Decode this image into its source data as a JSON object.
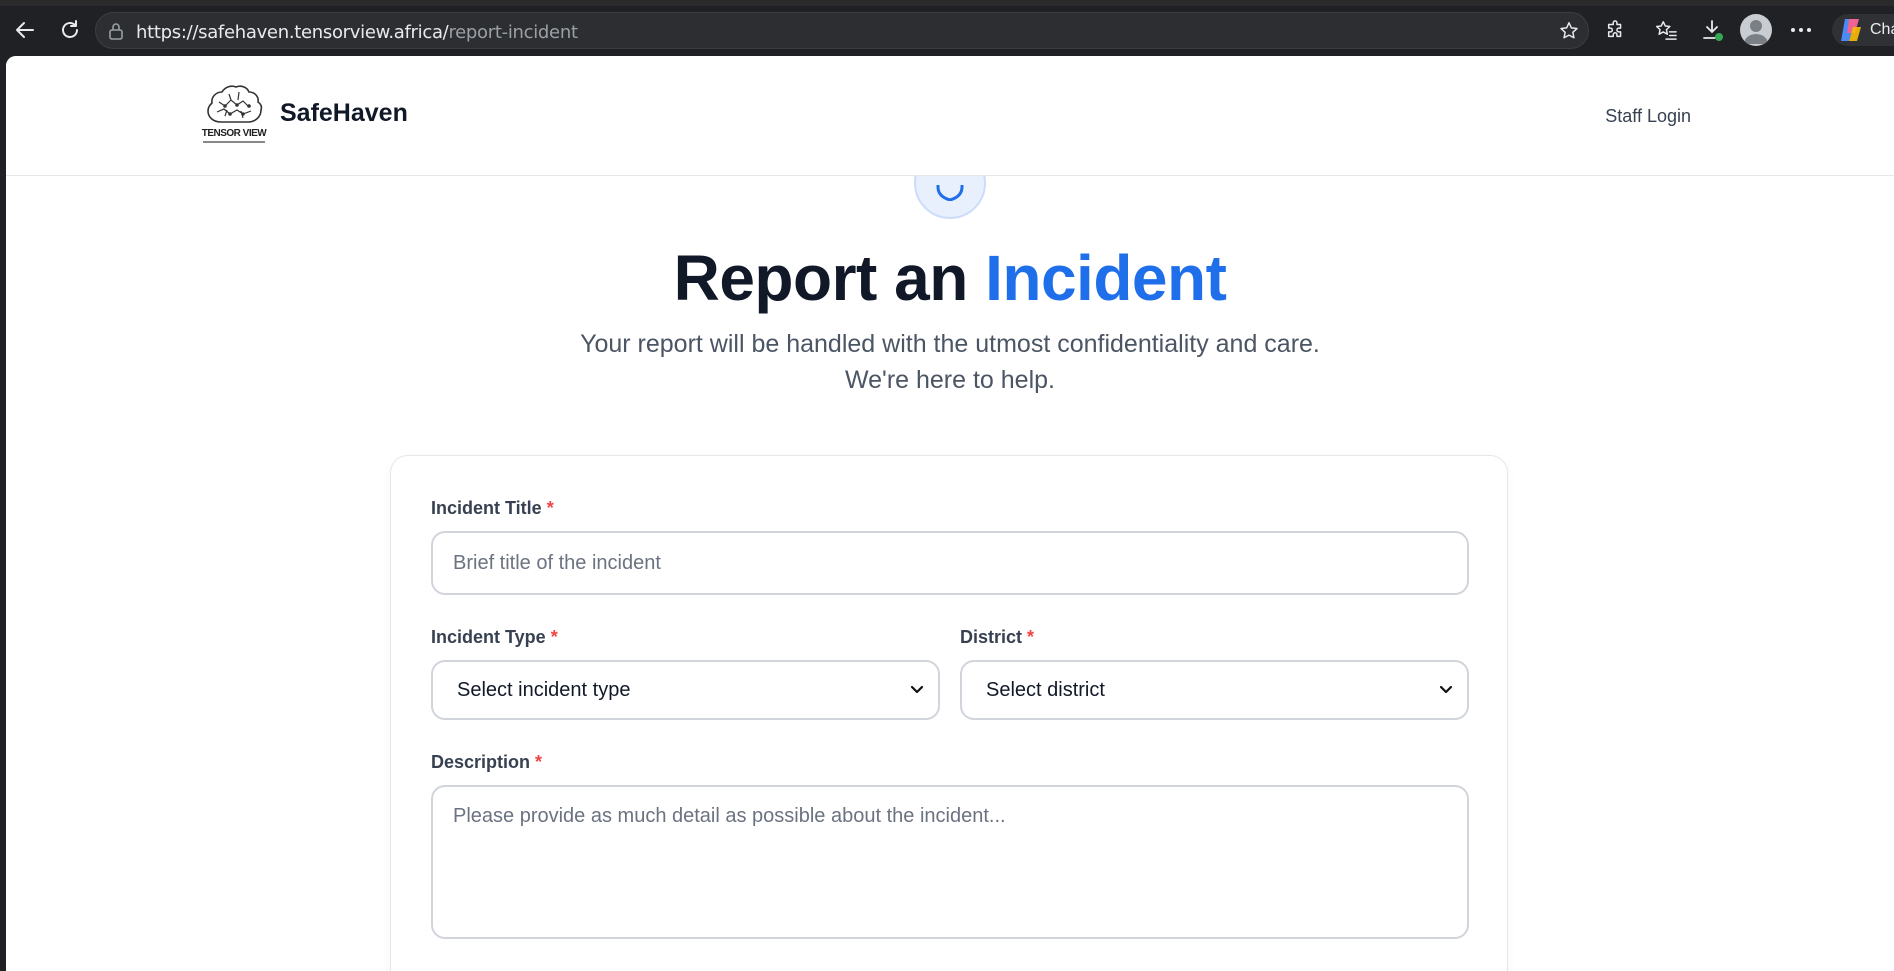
{
  "browser": {
    "url_host": "https://safehaven.tensorview.africa/",
    "url_path": "report-incident",
    "copilot_label": "Cha"
  },
  "header": {
    "logo_text": "TENSOR VIEW",
    "brand": "SafeHaven",
    "staff_login": "Staff Login"
  },
  "hero": {
    "title_main": "Report an",
    "title_accent": "Incident",
    "subtitle_line1": "Your report will be handled with the utmost confidentiality and care.",
    "subtitle_line2": "We're here to help."
  },
  "form": {
    "required_mark": "*",
    "title_label": "Incident Title",
    "title_placeholder": "Brief title of the incident",
    "type_label": "Incident Type",
    "type_value": "Select incident type",
    "district_label": "District",
    "district_value": "Select district",
    "description_label": "Description",
    "description_placeholder": "Please provide as much detail as possible about the incident..."
  },
  "colors": {
    "accent": "#1f6feb",
    "required": "#ef4444"
  }
}
